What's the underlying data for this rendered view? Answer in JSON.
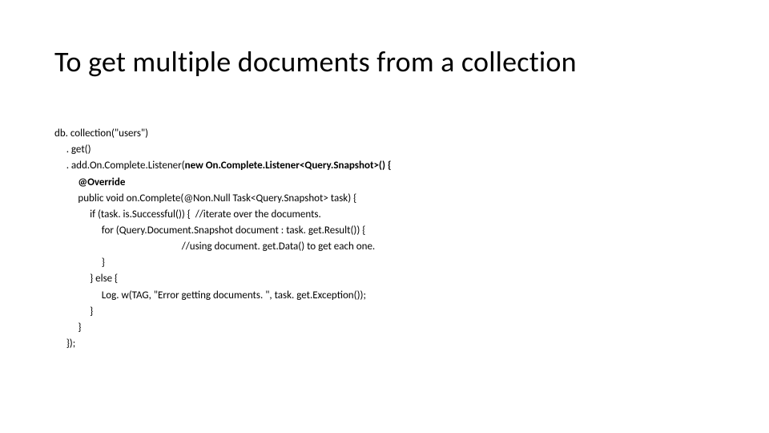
{
  "title": "To get multiple documents from a collection",
  "code": {
    "l1": "db. collection(\"users\")",
    "l2": "     . get()",
    "l3a": "     . add.On.Complete.Listener(",
    "l3b": "new On.Complete.Listener<Query.Snapshot>() {",
    "l4": "          @Override",
    "l5": "          public void on.Complete(@Non.Null Task<Query.Snapshot> task) {",
    "l6": "               if (task. is.Successful()) {  //iterate over the documents.",
    "l7": "                    for (Query.Document.Snapshot document : task. get.Result()) {",
    "l8": "                                                      //using document. get.Data() to get each one.",
    "l9": "                    }",
    "l10": "               } else {",
    "l11": "                    Log. w(TAG, \"Error getting documents. \", task. get.Exception());",
    "l12": "               }",
    "l13": "          }",
    "l14": "     });"
  }
}
